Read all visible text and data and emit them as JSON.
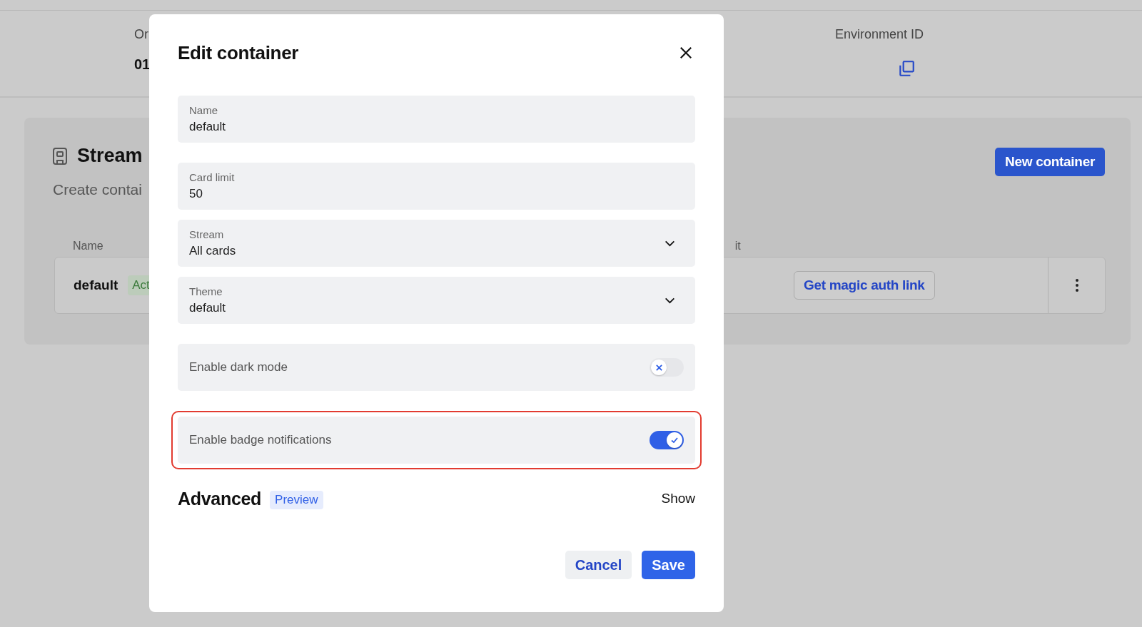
{
  "header": {
    "stats": [
      {
        "label": "Or",
        "value": "01"
      },
      {
        "label": "Environment ID"
      }
    ]
  },
  "section": {
    "title": "Stream",
    "subtitle": "Create contai",
    "button": "New container",
    "columns": [
      "Name",
      "it"
    ],
    "rows": [
      {
        "name": "default",
        "status": "Act",
        "action": "Get magic auth link"
      }
    ]
  },
  "modal": {
    "title": "Edit container",
    "fields": [
      {
        "kind": "text",
        "label": "Name",
        "value": "default"
      },
      {
        "kind": "text",
        "label": "Card limit",
        "value": "50"
      },
      {
        "kind": "select",
        "label": "Stream",
        "value": "All cards"
      },
      {
        "kind": "select",
        "label": "Theme",
        "value": "default"
      },
      {
        "kind": "toggle",
        "label": "Enable dark mode",
        "on": false,
        "highlighted": false
      },
      {
        "kind": "toggle",
        "label": "Enable badge notifications",
        "on": true,
        "highlighted": true
      }
    ],
    "advanced": {
      "title": "Advanced",
      "badge": "Preview",
      "action": "Show"
    },
    "buttons": [
      {
        "kind": "secondary",
        "label": "Cancel"
      },
      {
        "kind": "primary",
        "label": "Save"
      }
    ]
  }
}
